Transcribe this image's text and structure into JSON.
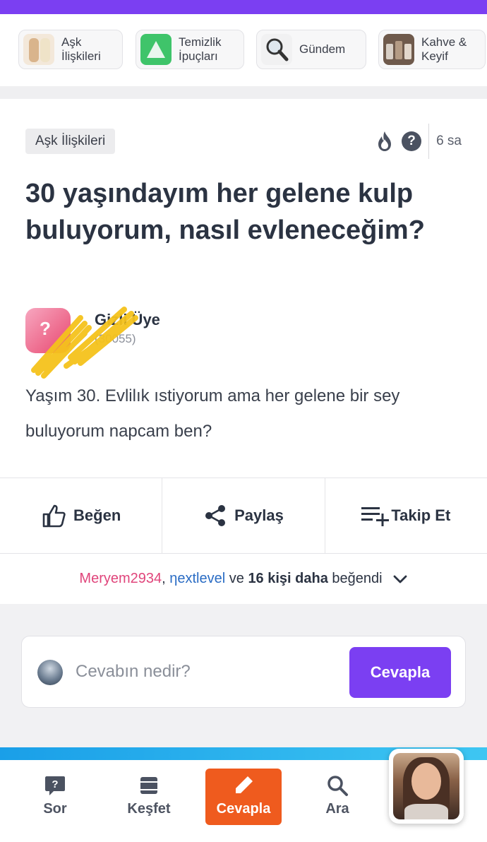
{
  "categories": [
    {
      "label": "Aşk\nİlişkileri",
      "icon": "couple-icon"
    },
    {
      "label": "Temizlik\nİpuçları",
      "icon": "cleaning-icon"
    },
    {
      "label": "Gündem",
      "icon": "magnifier-icon"
    },
    {
      "label": "Kahve &\nKeyif",
      "icon": "coffee-icon"
    }
  ],
  "question": {
    "tag": "Aşk İlişkileri",
    "age": "6 sa",
    "help": "?",
    "title": "30 yaşındayım her gelene kulp buluyorum, nasıl evleneceğim?",
    "author_name": "Gizli Üye",
    "author_points": "(30055)",
    "body": "Yaşım 30. Evlilık ıstiyorum ama her gelene bir sey buluyorum napcam ben?"
  },
  "actions": {
    "like": "Beğen",
    "share": "Paylaş",
    "follow": "Takip Et"
  },
  "likes": {
    "user1": "Meryem2934",
    "separator": ",",
    "user2": "ηextlevel",
    "and": "ve",
    "count_text": "16 kişi daha",
    "suffix": "beğendi"
  },
  "answer": {
    "placeholder": "Cevabın nedir?",
    "button": "Cevapla"
  },
  "bottom_nav": {
    "ask": "Sor",
    "discover": "Keşfet",
    "answer": "Cevapla",
    "search": "Ara"
  },
  "colors": {
    "brand_purple": "#7b3ff2",
    "answer_orange": "#ef5b1e",
    "user1_pink": "#e0457b",
    "user2_blue": "#2a6cc4"
  }
}
